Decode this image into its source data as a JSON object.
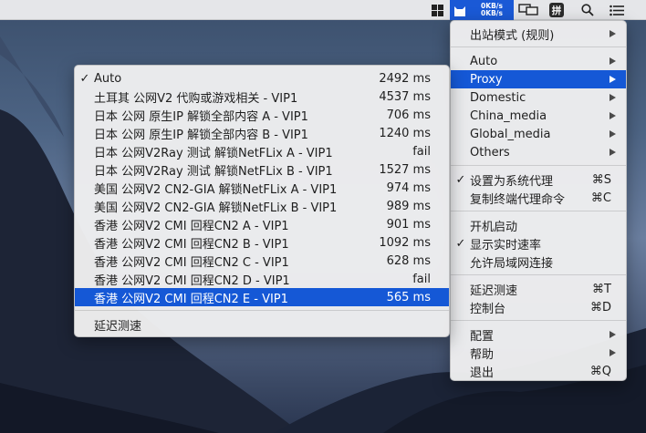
{
  "menubar": {
    "upload_speed": "0KB/s",
    "download_speed": "0KB/s",
    "input_method": "拼",
    "icons": [
      "flag-icon",
      "clash-cat-icon",
      "display-mirroring-icon",
      "input-method-icon",
      "spotlight-search-icon",
      "notification-center-icon"
    ],
    "accent_color": "#1a59d6"
  },
  "main_menu": {
    "outbound_mode": "出站模式 (规则)",
    "groups": [
      "Auto",
      "Proxy",
      "Domestic",
      "China_media",
      "Global_media",
      "Others"
    ],
    "selected_group": "Proxy",
    "set_system_proxy": "设置为系统代理",
    "set_system_proxy_shortcut": "⌘S",
    "copy_terminal_cmd": "复制终端代理命令",
    "copy_terminal_cmd_shortcut": "⌘C",
    "launch_at_login": "开机启动",
    "show_realtime_speed": "显示实时速率",
    "allow_lan": "允许局域网连接",
    "latency_test": "延迟测速",
    "latency_test_shortcut": "⌘T",
    "dashboard": "控制台",
    "dashboard_shortcut": "⌘D",
    "config": "配置",
    "help": "帮助",
    "quit": "退出",
    "quit_shortcut": "⌘Q"
  },
  "proxy_menu": {
    "items": [
      {
        "name": "Auto",
        "latency": "2492 ms",
        "checked": true
      },
      {
        "name": "土耳其 公网V2 代购或游戏相关 - VIP1",
        "latency": "4537 ms"
      },
      {
        "name": "日本 公网 原生IP 解锁全部内容 A - VIP1",
        "latency": "706 ms"
      },
      {
        "name": "日本 公网 原生IP 解锁全部内容 B - VIP1",
        "latency": "1240 ms"
      },
      {
        "name": "日本 公网V2Ray 测试 解锁NetFLix A - VIP1",
        "latency": "fail"
      },
      {
        "name": "日本 公网V2Ray 测试 解锁NetFLix B - VIP1",
        "latency": "1527 ms"
      },
      {
        "name": "美国 公网V2 CN2-GIA 解锁NetFLix A - VIP1",
        "latency": "974 ms"
      },
      {
        "name": "美国 公网V2 CN2-GIA 解锁NetFLix B - VIP1",
        "latency": "989 ms"
      },
      {
        "name": "香港 公网V2 CMI  回程CN2 A - VIP1",
        "latency": "901 ms"
      },
      {
        "name": "香港 公网V2 CMI  回程CN2 B - VIP1",
        "latency": "1092 ms"
      },
      {
        "name": "香港 公网V2 CMI  回程CN2 C - VIP1",
        "latency": "628 ms"
      },
      {
        "name": "香港 公网V2 CMI  回程CN2 D - VIP1",
        "latency": "fail"
      },
      {
        "name": "香港 公网V2 CMI  回程CN2 E - VIP1",
        "latency": "565 ms",
        "highlighted": true
      }
    ],
    "footer": "延迟测速"
  }
}
